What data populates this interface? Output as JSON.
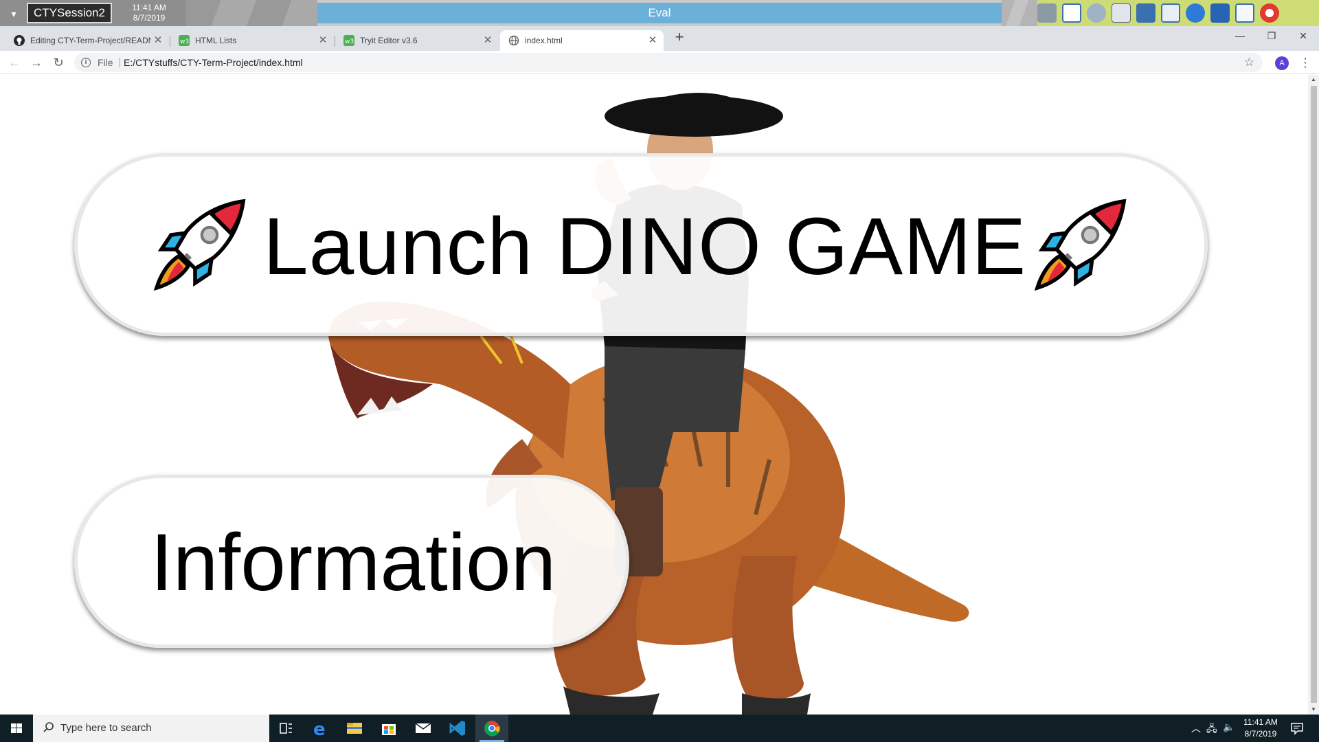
{
  "session": {
    "name": "CTYSession2",
    "time": "11:41 AM",
    "date": "8/7/2019",
    "center_label": "Eval"
  },
  "browser": {
    "tabs": [
      {
        "title": "Editing CTY-Term-Project/READM",
        "favicon": "github-icon",
        "active": false
      },
      {
        "title": "HTML Lists",
        "favicon": "w3schools-icon",
        "active": false
      },
      {
        "title": "Tryit Editor v3.6",
        "favicon": "w3schools-icon",
        "active": false
      },
      {
        "title": "index.html",
        "favicon": "globe-icon",
        "active": true
      }
    ],
    "scheme_label": "File",
    "url": "E:/CTYstuffs/CTY-Term-Project/index.html",
    "profile_initial": "A"
  },
  "page": {
    "launch_button": "Launch DINO GAME",
    "info_button": "Information"
  },
  "taskbar": {
    "search_placeholder": "Type here to search",
    "time": "11:41 AM",
    "date": "8/7/2019",
    "apps": [
      "task-view",
      "edge",
      "file-explorer",
      "store",
      "mail",
      "vscode",
      "chrome"
    ],
    "running_app": "chrome"
  },
  "colors": {
    "eval_bar": "#6ab0d8",
    "tool_strip": "#cddc74",
    "taskbar": "#101e26",
    "dino_orange": "#c06a28",
    "rocket_red": "#e2283a",
    "rocket_cyan": "#2eb2e6"
  }
}
